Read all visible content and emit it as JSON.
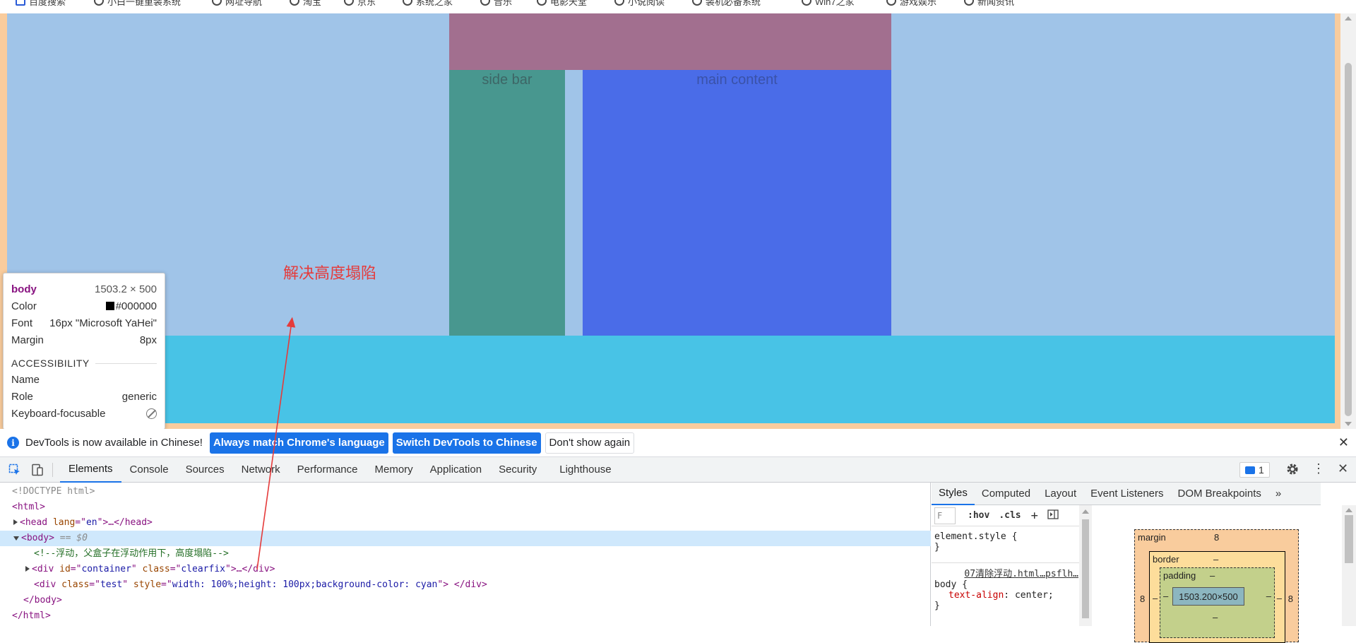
{
  "bookmarks": [
    {
      "label": "百度搜索"
    },
    {
      "label": "小白一键重装系统"
    },
    {
      "label": "网址导航"
    },
    {
      "label": "淘宝"
    },
    {
      "label": "京东"
    },
    {
      "label": "系统之家"
    },
    {
      "label": "音乐"
    },
    {
      "label": "电影天堂"
    },
    {
      "label": "小说阅读"
    },
    {
      "label": "装机必备系统"
    },
    {
      "label": "Win7之家"
    },
    {
      "label": "游戏娱乐"
    },
    {
      "label": "新闻资讯"
    }
  ],
  "page": {
    "sidebar_text": "side bar",
    "main_text": "main content",
    "annotation": "解决高度塌陷",
    "colors": {
      "body": "#a0c4e8",
      "header": "#a26f8f",
      "sidebar": "#48978f",
      "main": "#4a6ce8",
      "test": "#48c3e6",
      "margin": "#f9cc9d"
    }
  },
  "tooltip": {
    "tag": "body",
    "size": "1503.2 × 500",
    "color_label": "Color",
    "color_value": "#000000",
    "font_label": "Font",
    "font_value": "16px \"Microsoft YaHei\"",
    "margin_label": "Margin",
    "margin_value": "8px",
    "accessibility_heading": "ACCESSIBILITY",
    "name_label": "Name",
    "role_label": "Role",
    "role_value": "generic",
    "focusable_label": "Keyboard-focusable"
  },
  "infobar": {
    "message": "DevTools is now available in Chinese!",
    "btn_match": "Always match Chrome's language",
    "btn_switch": "Switch DevTools to Chinese",
    "btn_dismiss": "Don't show again",
    "close": "✕"
  },
  "devtools": {
    "tabs": [
      "Elements",
      "Console",
      "Sources",
      "Network",
      "Performance",
      "Memory",
      "Application",
      "Security",
      "Lighthouse"
    ],
    "active_tab": "Elements",
    "issues_count": "1"
  },
  "dom": {
    "l1": "<!DOCTYPE html>",
    "l2_tag": "<html>",
    "l3_open": "<head",
    "l3_attr": " lang",
    "l3_eq": "=\"",
    "l3_val": "en",
    "l3_close": "\">…</head>",
    "l4_tag": "<body>",
    "l4_eq": " == $0",
    "l5_comment": "<!--浮动，父盒子在浮动作用下，高度塌陷-->",
    "l6_open": "<div",
    "l6_a1": " id",
    "l6_v1": "container",
    "l6_a2": " class",
    "l6_v2": "clearfix",
    "l6_close": ">…</div>",
    "l7_open": "<div",
    "l7_a1": " class",
    "l7_v1": "test",
    "l7_a2": " style",
    "l7_v2": "width: 100%;height: 100px;background-color: cyan",
    "l7_close": "> </div>",
    "l8": "</body>",
    "l9": "</html>"
  },
  "styles": {
    "tabs": [
      "Styles",
      "Computed",
      "Layout",
      "Event Listeners",
      "DOM Breakpoints"
    ],
    "active_tab": "Styles",
    "filter_placeholder": "F",
    "hov": ":hov",
    "cls": ".cls",
    "rule1_selector": "element.style {",
    "rule1_close": "}",
    "rule2_source": "07清除浮动.html…psflh…",
    "rule2_selector": "body {",
    "rule2_prop": "text-align",
    "rule2_value": "center;",
    "rule2_close": "}"
  },
  "boxmodel": {
    "margin_label": "margin",
    "margin_top": "8",
    "margin_left": "8",
    "margin_right": "8",
    "border_label": "border",
    "border_value": "–",
    "padding_label": "padding",
    "padding_value": "–",
    "content": "1503.200×500",
    "dash": "–"
  }
}
